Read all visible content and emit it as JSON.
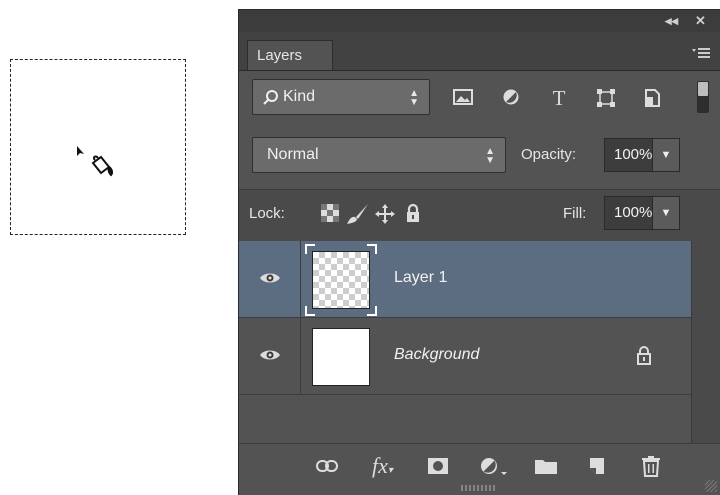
{
  "canvas": {
    "cursor_icon": "paint-bucket-cursor-icon"
  },
  "panel": {
    "collapse_label": "◂◂",
    "close_label": "✕",
    "tab_label": "Layers",
    "filter": {
      "label": "Kind",
      "icons": [
        "image-filter-icon",
        "adjustment-filter-icon",
        "type-filter-icon",
        "shape-filter-icon",
        "smart-object-filter-icon"
      ],
      "type_glyph": "T"
    },
    "blend_mode": "Normal",
    "opacity_label": "Opacity:",
    "opacity_value": "100%",
    "lock_label": "Lock:",
    "fill_label": "Fill:",
    "fill_value": "100%",
    "layers": [
      {
        "name": "Layer 1",
        "visible": true,
        "selected": true,
        "transparent": true,
        "locked": false
      },
      {
        "name": "Background",
        "visible": true,
        "selected": false,
        "transparent": false,
        "locked": true
      }
    ],
    "bottom_icons": [
      "link-layers-icon",
      "fx-icon",
      "layer-mask-icon",
      "adjustment-layer-icon",
      "new-group-icon",
      "new-layer-icon",
      "delete-layer-icon"
    ],
    "fx_label": "fx"
  }
}
